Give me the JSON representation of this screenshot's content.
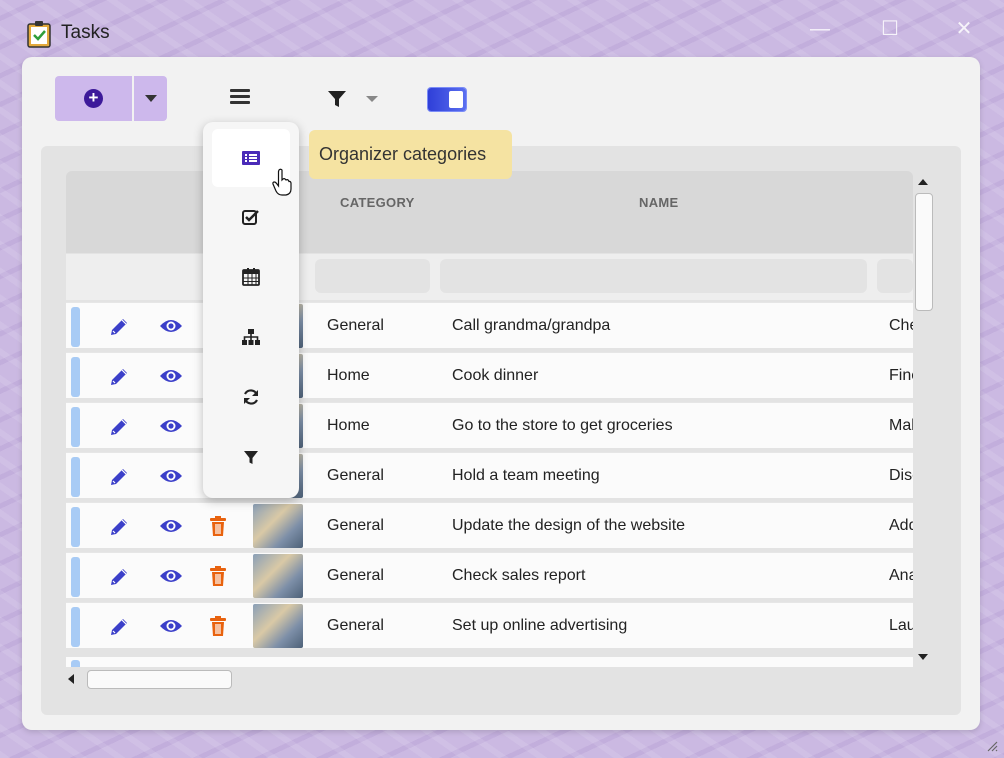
{
  "window": {
    "title": "Tasks",
    "minimize_glyph": "—",
    "maximize_glyph": "☐",
    "close_glyph": "✕"
  },
  "toolbar": {
    "add_icon": "plus-circle-icon",
    "add_dropdown_icon": "caret-down-icon",
    "menu_icon": "hamburger-menu-icon",
    "filter_icon": "filter-icon",
    "filter_dropdown_icon": "caret-down-icon",
    "toggle_state": "on"
  },
  "popup_menu": {
    "items": [
      {
        "icon": "list-icon",
        "active": true
      },
      {
        "icon": "checkbox-icon",
        "active": false
      },
      {
        "icon": "calendar-icon",
        "active": false
      },
      {
        "icon": "hierarchy-icon",
        "active": false
      },
      {
        "icon": "refresh-icon",
        "active": false
      },
      {
        "icon": "filter-icon",
        "active": false
      }
    ]
  },
  "tooltip": {
    "text": "Organizer categories"
  },
  "grid": {
    "columns": {
      "category": "CATEGORY",
      "name": "NAME"
    },
    "rows": [
      {
        "category": "General",
        "name": "Call grandma/grandpa",
        "desc": "Che"
      },
      {
        "category": "Home",
        "name": "Cook dinner",
        "desc": "Fine"
      },
      {
        "category": "Home",
        "name": "Go to the store to get groceries",
        "desc": "Mal"
      },
      {
        "category": "General",
        "name": "Hold a team meeting",
        "desc": "Disc"
      },
      {
        "category": "General",
        "name": "Update the design of the website",
        "desc": "Add"
      },
      {
        "category": "General",
        "name": "Check sales report",
        "desc": "Ana"
      },
      {
        "category": "General",
        "name": "Set up online advertising",
        "desc": "Lau"
      }
    ]
  },
  "colors": {
    "accent": "#3d1a9a",
    "edit_icon": "#3b3fc9",
    "view_icon": "#3b3fc9",
    "trash_icon": "#e8620e",
    "row_stripe": "#a8cbf5",
    "tooltip_bg": "#f5e3a2",
    "add_button_bg": "#cdb8ec"
  }
}
